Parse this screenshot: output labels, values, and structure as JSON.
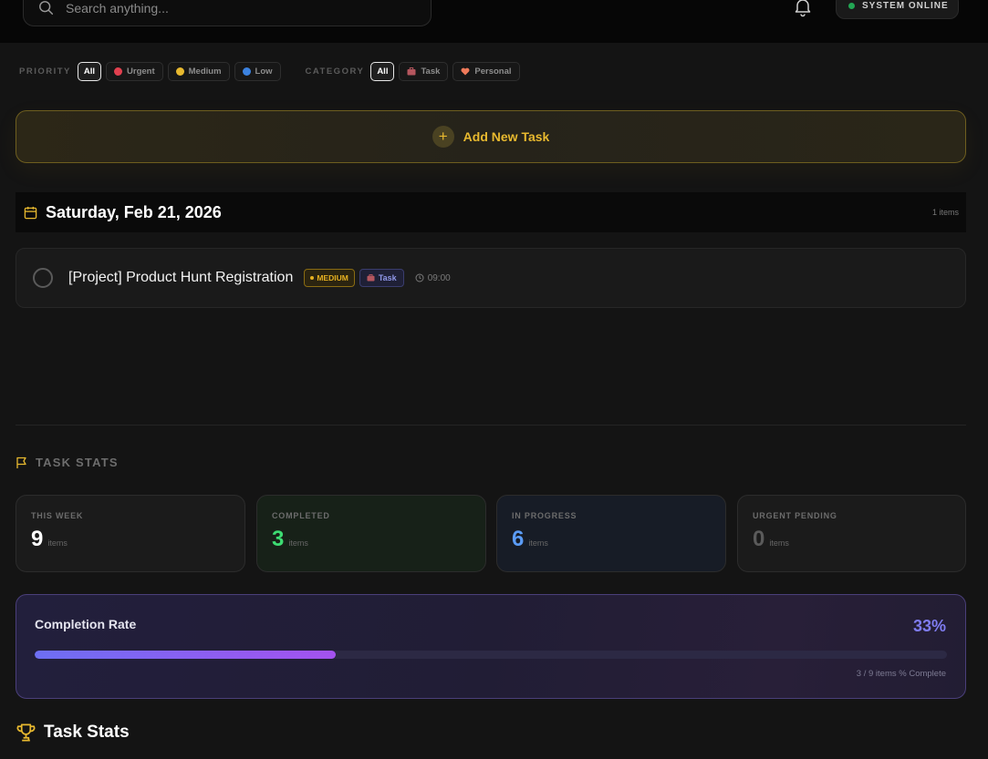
{
  "header": {
    "search_placeholder": "Search anything...",
    "status": "SYSTEM ONLINE"
  },
  "filters": {
    "priority_label": "PRIORITY",
    "priority_options": [
      "All",
      "Urgent",
      "Medium",
      "Low"
    ],
    "category_label": "CATEGORY",
    "category_options": [
      "All",
      "Task",
      "Personal"
    ]
  },
  "add_task_label": "Add New Task",
  "day": {
    "date": "Saturday, Feb 21, 2026",
    "count": "1 items",
    "tasks": [
      {
        "title": "[Project] Product Hunt Registration",
        "priority": "MEDIUM",
        "category": "Task",
        "time": "09:00"
      }
    ]
  },
  "stats": {
    "title": "TASK STATS",
    "cards": [
      {
        "label": "THIS WEEK",
        "value": "9",
        "unit": "items",
        "color": "#ffffff",
        "bg": "#1b1b1b"
      },
      {
        "label": "COMPLETED",
        "value": "3",
        "unit": "items",
        "color": "#3ddc72",
        "bg": "#172118"
      },
      {
        "label": "IN PROGRESS",
        "value": "6",
        "unit": "items",
        "color": "#5b9cf6",
        "bg": "#171c26"
      },
      {
        "label": "URGENT PENDING",
        "value": "0",
        "unit": "items",
        "color": "#5a5a5a",
        "bg": "#1b1b1b"
      }
    ]
  },
  "completion": {
    "label": "Completion Rate",
    "percent_text": "33%",
    "fraction": 0.33,
    "note": "3 / 9 items % Complete"
  },
  "section_title": "Task Stats",
  "colors": {
    "accent": "#e8b92f",
    "urgent": "#e2404f",
    "medium": "#e8b92f",
    "low": "#3b82e0",
    "online": "#22a653"
  }
}
